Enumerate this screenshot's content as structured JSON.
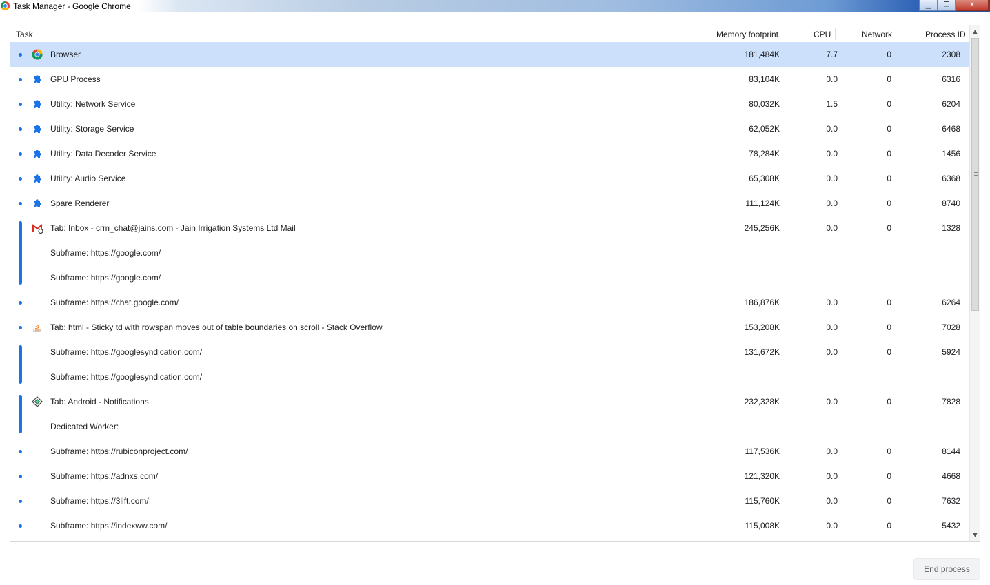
{
  "window": {
    "title": "Task Manager - Google Chrome",
    "minimize_glyph": "▁",
    "maximize_glyph": "❐",
    "close_glyph": "✕"
  },
  "columns": {
    "task": "Task",
    "memory": "Memory footprint",
    "cpu": "CPU",
    "network": "Network",
    "pid": "Process ID"
  },
  "colors": {
    "selection": "#cce0fb",
    "accent": "#1a73e8"
  },
  "rows": [
    {
      "icon": "chrome-icon",
      "task": "Browser",
      "memory": "181,484K",
      "cpu": "7.7",
      "network": "0",
      "pid": "2308",
      "selected": true
    },
    {
      "icon": "puzzle-icon",
      "task": "GPU Process",
      "memory": "83,104K",
      "cpu": "0.0",
      "network": "0",
      "pid": "6316"
    },
    {
      "icon": "puzzle-icon",
      "task": "Utility: Network Service",
      "memory": "80,032K",
      "cpu": "1.5",
      "network": "0",
      "pid": "6204"
    },
    {
      "icon": "puzzle-icon",
      "task": "Utility: Storage Service",
      "memory": "62,052K",
      "cpu": "0.0",
      "network": "0",
      "pid": "6468"
    },
    {
      "icon": "puzzle-icon",
      "task": "Utility: Data Decoder Service",
      "memory": "78,284K",
      "cpu": "0.0",
      "network": "0",
      "pid": "1456"
    },
    {
      "icon": "puzzle-icon",
      "task": "Utility: Audio Service",
      "memory": "65,308K",
      "cpu": "0.0",
      "network": "0",
      "pid": "6368"
    },
    {
      "icon": "puzzle-icon",
      "task": "Spare Renderer",
      "memory": "111,124K",
      "cpu": "0.0",
      "network": "0",
      "pid": "8740"
    },
    {
      "icon": "gmail-icon",
      "task": "Tab: Inbox - crm_chat@jains.com - Jain Irrigation Systems Ltd Mail",
      "memory": "245,256K",
      "cpu": "0.0",
      "network": "0",
      "pid": "1328"
    },
    {
      "icon": "",
      "task": "Subframe: https://google.com/",
      "memory": "",
      "cpu": "",
      "network": "",
      "pid": ""
    },
    {
      "icon": "",
      "task": "Subframe: https://google.com/",
      "memory": "",
      "cpu": "",
      "network": "",
      "pid": ""
    },
    {
      "icon": "",
      "task": "Subframe: https://chat.google.com/",
      "memory": "186,876K",
      "cpu": "0.0",
      "network": "0",
      "pid": "6264"
    },
    {
      "icon": "stackoverflow-icon",
      "task": "Tab: html - Sticky td with rowspan moves out of table boundaries on scroll - Stack Overflow",
      "memory": "153,208K",
      "cpu": "0.0",
      "network": "0",
      "pid": "7028"
    },
    {
      "icon": "",
      "task": "Subframe: https://googlesyndication.com/",
      "memory": "131,672K",
      "cpu": "0.0",
      "network": "0",
      "pid": "5924"
    },
    {
      "icon": "",
      "task": "Subframe: https://googlesyndication.com/",
      "memory": "",
      "cpu": "",
      "network": "",
      "pid": ""
    },
    {
      "icon": "android-notifications-icon",
      "task": "Tab: Android - Notifications",
      "memory": "232,328K",
      "cpu": "0.0",
      "network": "0",
      "pid": "7828"
    },
    {
      "icon": "",
      "task": "Dedicated Worker:",
      "memory": "",
      "cpu": "",
      "network": "",
      "pid": ""
    },
    {
      "icon": "",
      "task": "Subframe: https://rubiconproject.com/",
      "memory": "117,536K",
      "cpu": "0.0",
      "network": "0",
      "pid": "8144"
    },
    {
      "icon": "",
      "task": "Subframe: https://adnxs.com/",
      "memory": "121,320K",
      "cpu": "0.0",
      "network": "0",
      "pid": "4668"
    },
    {
      "icon": "",
      "task": "Subframe: https://3lift.com/",
      "memory": "115,760K",
      "cpu": "0.0",
      "network": "0",
      "pid": "7632"
    },
    {
      "icon": "",
      "task": "Subframe: https://indexww.com/",
      "memory": "115,008K",
      "cpu": "0.0",
      "network": "0",
      "pid": "5432"
    }
  ],
  "groups": [
    {
      "first_row": 7,
      "row_count": 3
    },
    {
      "first_row": 12,
      "row_count": 2
    },
    {
      "first_row": 14,
      "row_count": 2
    }
  ],
  "footer": {
    "end_process_label": "End process"
  }
}
